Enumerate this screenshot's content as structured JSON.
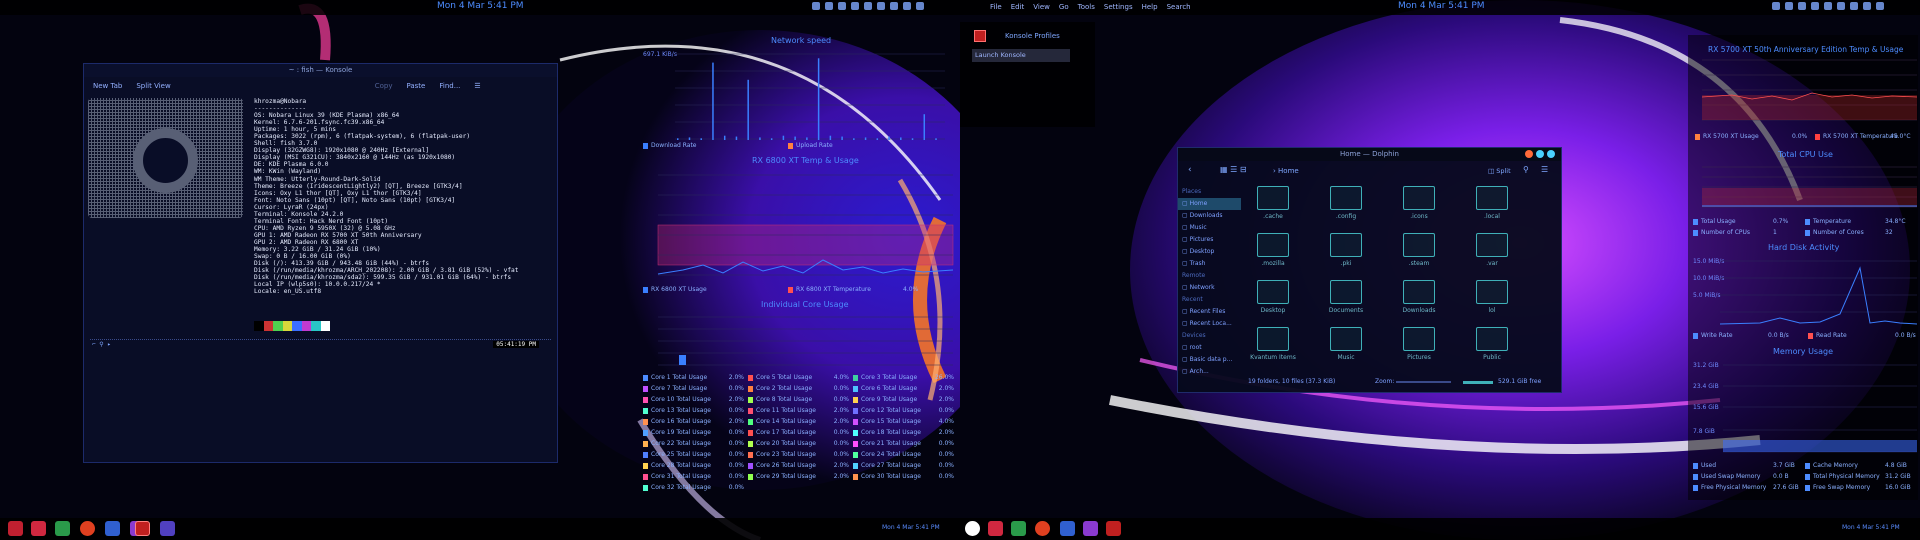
{
  "left": {
    "clock": "Mon 4 Mar 5:41 PM",
    "taskbar_clock": "Mon 4 Mar 5:41 PM",
    "konsole": {
      "title": "~ : fish — Konsole",
      "toolbar": [
        "New Tab",
        "Split View",
        "Copy",
        "Paste",
        "Find..."
      ],
      "neofetch": [
        "khrozma@Nobara",
        "--------------",
        "OS: Nobara Linux 39 (KDE Plasma) x86_64",
        "Kernel: 6.7.6-201.fsync.fc39.x86_64",
        "Uptime: 1 hour, 5 mins",
        "Packages: 3022 (rpm), 6 (flatpak-system), 6 (flatpak-user)",
        "Shell: fish 3.7.0",
        "Display (32GZWG8): 1920x1080 @ 240Hz [External]",
        "Display (MSI G321CU): 3840x2160 @ 144Hz (as 1920x1080)",
        "DE: KDE Plasma 6.0.0",
        "WM: KWin (Wayland)",
        "WM Theme: Utterly-Round-Dark-Solid",
        "Theme: Breeze (IridescentLightly2) [QT], Breeze [GTK3/4]",
        "Icons: Oxy L1 thor [QT], Oxy L1 thor [GTK3/4]",
        "Font: Noto Sans (10pt) [QT], Noto Sans (10pt) [GTK3/4]",
        "Cursor: LyraR (24px)",
        "Terminal: Konsole 24.2.0",
        "Terminal Font: Hack Nerd Font (10pt)",
        "CPU: AMD Ryzen 9 5950X (32) @ 5.08 GHz",
        "GPU 1: AMD Radeon RX 5700 XT 50th Anniversary",
        "GPU 2: AMD Radeon RX 6800 XT",
        "Memory: 3.22 GiB / 31.24 GiB (10%)",
        "Swap: 0 B / 16.00 GiB (0%)",
        "Disk (/): 413.39 GiB / 943.48 GiB (44%) - btrfs",
        "Disk (/run/media/khrozma/ARCH_202208): 2.00 GiB / 3.81 GiB (52%) - vfat",
        "Disk (/run/media/khrozma/sda2): 599.35 GiB / 931.01 GiB (64%) - btrfs",
        "Local IP (wlp5s0): 10.0.0.217/24 *",
        "Locale: en_US.utf8"
      ],
      "palette": [
        "#000000",
        "#cc3333",
        "#4fd04f",
        "#d8d83a",
        "#3a6fff",
        "#c13ad0",
        "#29c6c6",
        "#ffffff"
      ],
      "prompt_time": "05:41:19 PM"
    },
    "network": {
      "title": "Network speed",
      "ymax_label": "697.1 KiB/s",
      "legend_down": "Download Rate",
      "legend_up": "Upload Rate",
      "download_values": [
        0.02,
        0.03,
        0.02,
        0.9,
        0.05,
        0.04,
        0.7,
        0.03,
        0.02,
        0.05,
        0.04,
        0.03,
        0.95,
        0.05,
        0.04,
        0.02,
        0.03,
        0.02,
        0.04,
        0.03,
        0.02,
        0.3,
        0.02
      ]
    },
    "gpu_temp": {
      "title": "RX 6800 XT Temp & Usage",
      "legend_usage": "RX 6800 XT Usage",
      "legend_temp": "RX 6800 XT Temperature",
      "usage_value": "4.0%"
    },
    "cpu": {
      "title": "Individual Core Usage",
      "cores": [
        {
          "label": "Core 1 Total Usage",
          "value": "2.0%",
          "color": "#4d8cff"
        },
        {
          "label": "Core 5 Total Usage",
          "value": "4.0%",
          "color": "#ff5050"
        },
        {
          "label": "Core 3 Total Usage",
          "value": "26.0%",
          "color": "#3fd0a0"
        },
        {
          "label": "Core 7 Total Usage",
          "value": "0.0%",
          "color": "#c050ff"
        },
        {
          "label": "Core 2 Total Usage",
          "value": "0.0%",
          "color": "#ff8040"
        },
        {
          "label": "Core 6 Total Usage",
          "value": "2.0%",
          "color": "#50c0ff"
        },
        {
          "label": "Core 10 Total Usage",
          "value": "2.0%",
          "color": "#ff50b0"
        },
        {
          "label": "Core 8 Total Usage",
          "value": "0.0%",
          "color": "#a0ff50"
        },
        {
          "label": "Core 9 Total Usage",
          "value": "2.0%",
          "color": "#ffd050"
        },
        {
          "label": "Core 13 Total Usage",
          "value": "0.0%",
          "color": "#50ffd0"
        },
        {
          "label": "Core 11 Total Usage",
          "value": "2.0%",
          "color": "#ff5070"
        },
        {
          "label": "Core 12 Total Usage",
          "value": "0.0%",
          "color": "#7070ff"
        },
        {
          "label": "Core 16 Total Usage",
          "value": "2.0%",
          "color": "#ff9050"
        },
        {
          "label": "Core 14 Total Usage",
          "value": "2.0%",
          "color": "#50ff80"
        },
        {
          "label": "Core 15 Total Usage",
          "value": "4.0%",
          "color": "#d050ff"
        },
        {
          "label": "Core 19 Total Usage",
          "value": "0.0%",
          "color": "#50a0ff"
        },
        {
          "label": "Core 17 Total Usage",
          "value": "0.0%",
          "color": "#ff5050"
        },
        {
          "label": "Core 18 Total Usage",
          "value": "2.0%",
          "color": "#50ffff"
        },
        {
          "label": "Core 22 Total Usage",
          "value": "0.0%",
          "color": "#ffb050"
        },
        {
          "label": "Core 20 Total Usage",
          "value": "0.0%",
          "color": "#b0ff50"
        },
        {
          "label": "Core 21 Total Usage",
          "value": "0.0%",
          "color": "#ff50ff"
        },
        {
          "label": "Core 25 Total Usage",
          "value": "0.0%",
          "color": "#5080ff"
        },
        {
          "label": "Core 23 Total Usage",
          "value": "0.0%",
          "color": "#ff7050"
        },
        {
          "label": "Core 24 Total Usage",
          "value": "0.0%",
          "color": "#50ffa0"
        },
        {
          "label": "Core 28 Total Usage",
          "value": "0.0%",
          "color": "#ffd050"
        },
        {
          "label": "Core 26 Total Usage",
          "value": "2.0%",
          "color": "#a050ff"
        },
        {
          "label": "Core 27 Total Usage",
          "value": "0.0%",
          "color": "#50d0ff"
        },
        {
          "label": "Core 31 Total Usage",
          "value": "0.0%",
          "color": "#ff5090"
        },
        {
          "label": "Core 29 Total Usage",
          "value": "2.0%",
          "color": "#90ff50"
        },
        {
          "label": "Core 30 Total Usage",
          "value": "0.0%",
          "color": "#ff9050"
        },
        {
          "label": "Core 32 Total Usage",
          "value": "0.0%",
          "color": "#50ffd0"
        }
      ]
    }
  },
  "right": {
    "clock": "Mon 4 Mar 5:41 PM",
    "taskbar_clock": "Mon 4 Mar 5:41 PM",
    "menu": [
      "File",
      "Edit",
      "View",
      "Go",
      "Tools",
      "Settings",
      "Help",
      "Search"
    ],
    "konsole_profiles": {
      "title": "Konsole Profiles",
      "item": "Launch Konsole"
    },
    "dolphin": {
      "title": "Home — Dolphin",
      "breadcrumb": "Home",
      "split_label": "Split",
      "places_header": "Places",
      "places": [
        "Home",
        "Downloads",
        "Music",
        "Pictures",
        "Desktop",
        "Trash"
      ],
      "remote_header": "Remote",
      "remote": [
        "Network"
      ],
      "recent_header": "Recent",
      "recent": [
        "Recent Files",
        "Recent Loca..."
      ],
      "devices_header": "Devices",
      "devices": [
        "root",
        "Basic data p...",
        "Arch..."
      ],
      "folders": [
        ".cache",
        ".config",
        ".icons",
        ".local",
        ".mozilla",
        ".pki",
        ".steam",
        ".var",
        "Desktop",
        "Documents",
        "Downloads",
        "lol",
        "Kvantum Items",
        "Music",
        "Pictures",
        "Public"
      ],
      "status": "19 folders, 10 files (37.3 KiB)",
      "zoom_label": "Zoom:",
      "free_space": "529.1 GiB free"
    },
    "gpu_temp": {
      "title": "RX 5700 XT 50th Anniversary Edition Temp & Usage",
      "legend_usage": "RX 5700 XT Usage",
      "usage_value": "0.0%",
      "legend_temp": "RX 5700 XT Temperature",
      "temp_value": "45.0°C"
    },
    "total_cpu": {
      "title": "Total CPU Use",
      "rows": [
        {
          "label": "Total Usage",
          "value": "0.7%"
        },
        {
          "label": "Temperature",
          "value": "34.8°C"
        },
        {
          "label": "Number of CPUs",
          "value": "1"
        },
        {
          "label": "Number of Cores",
          "value": "32"
        }
      ]
    },
    "disk": {
      "title": "Hard Disk Activity",
      "write_label": "Write Rate",
      "write_value": "0.0 B/s",
      "read_label": "Read Rate",
      "read_value": "0.0 B/s",
      "ticks": [
        "15.0 MiB/s",
        "10.0 MiB/s",
        "5.0 MiB/s"
      ]
    },
    "memory": {
      "title": "Memory Usage",
      "ticks": [
        "31.2 GiB",
        "23.4 GiB",
        "15.6 GiB",
        "7.8 GiB"
      ],
      "rows": [
        {
          "label": "Used",
          "value": "3.7 GiB"
        },
        {
          "label": "Cache Memory",
          "value": "4.8 GiB"
        },
        {
          "label": "Used Swap Memory",
          "value": "0.0 B"
        },
        {
          "label": "Total Physical Memory",
          "value": "31.2 GiB"
        },
        {
          "label": "Free Physical Memory",
          "value": "27.6 GiB"
        },
        {
          "label": "Free Swap Memory",
          "value": "16.0 GiB"
        }
      ]
    }
  }
}
